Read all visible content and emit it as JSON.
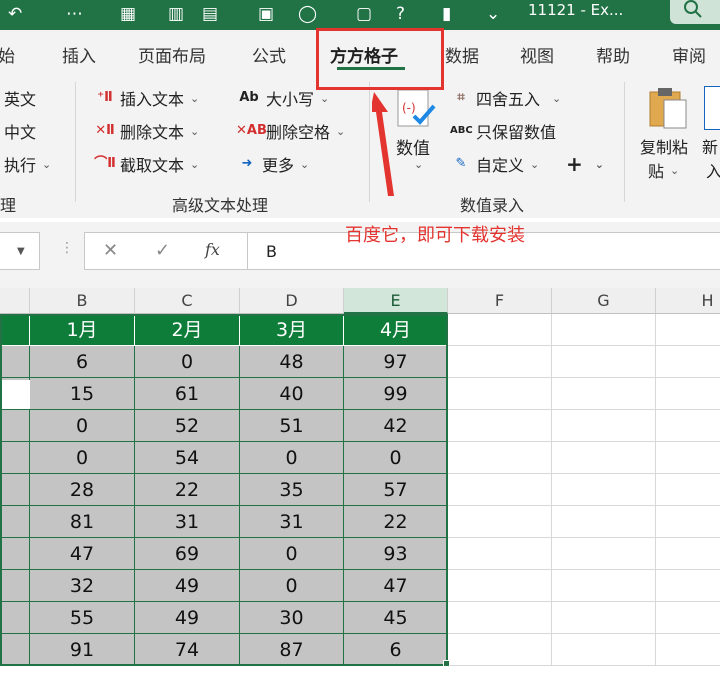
{
  "titlebar": {
    "title": "11121 - Ex...",
    "bg_color": "#217346"
  },
  "tabs": [
    {
      "label": "开始",
      "display": "始"
    },
    {
      "label": "插入"
    },
    {
      "label": "页面布局"
    },
    {
      "label": "公式"
    },
    {
      "label": "方方格子",
      "active": true
    },
    {
      "label": "数据"
    },
    {
      "label": "视图"
    },
    {
      "label": "帮助"
    },
    {
      "label": "审阅"
    }
  ],
  "ribbon": {
    "left_group": {
      "items": [
        "英文",
        "中文",
        "执行"
      ],
      "group_label": "理"
    },
    "text_group": {
      "insert": "插入文本",
      "delete": "删除文本",
      "extract": "截取文本",
      "case": "大小写",
      "delete_space": "删除空格",
      "more": "更多",
      "group_label": "高级文本处理"
    },
    "number_group": {
      "value": "数值",
      "round": "四舍五入",
      "keep_value": "只保留数值",
      "custom": "自定义",
      "add": "+",
      "group_label": "数值录入"
    },
    "copy_paste": {
      "line1": "复制粘",
      "line2": "贴"
    },
    "new_label": {
      "line1": "新",
      "line2": "入"
    }
  },
  "annotation": {
    "text": "百度它，即可下载安装",
    "color": "#e3342f"
  },
  "formula_bar": {
    "cancel": "✕",
    "confirm": "✓",
    "fx": "fx",
    "content": "B"
  },
  "grid": {
    "columns": [
      "B",
      "C",
      "D",
      "E",
      "F",
      "G",
      "H"
    ],
    "selected_column": "E",
    "header_row": [
      "1月",
      "2月",
      "3月",
      "4月"
    ],
    "rows": [
      [
        6,
        0,
        48,
        97
      ],
      [
        15,
        61,
        40,
        99
      ],
      [
        0,
        52,
        51,
        42
      ],
      [
        0,
        54,
        0,
        0
      ],
      [
        28,
        22,
        35,
        57
      ],
      [
        81,
        31,
        31,
        22
      ],
      [
        47,
        69,
        0,
        93
      ],
      [
        32,
        49,
        0,
        47
      ],
      [
        55,
        49,
        30,
        45
      ],
      [
        91,
        74,
        87,
        6
      ]
    ],
    "header_color": "#0e7d3a",
    "data_color": "#c4c4c4"
  }
}
